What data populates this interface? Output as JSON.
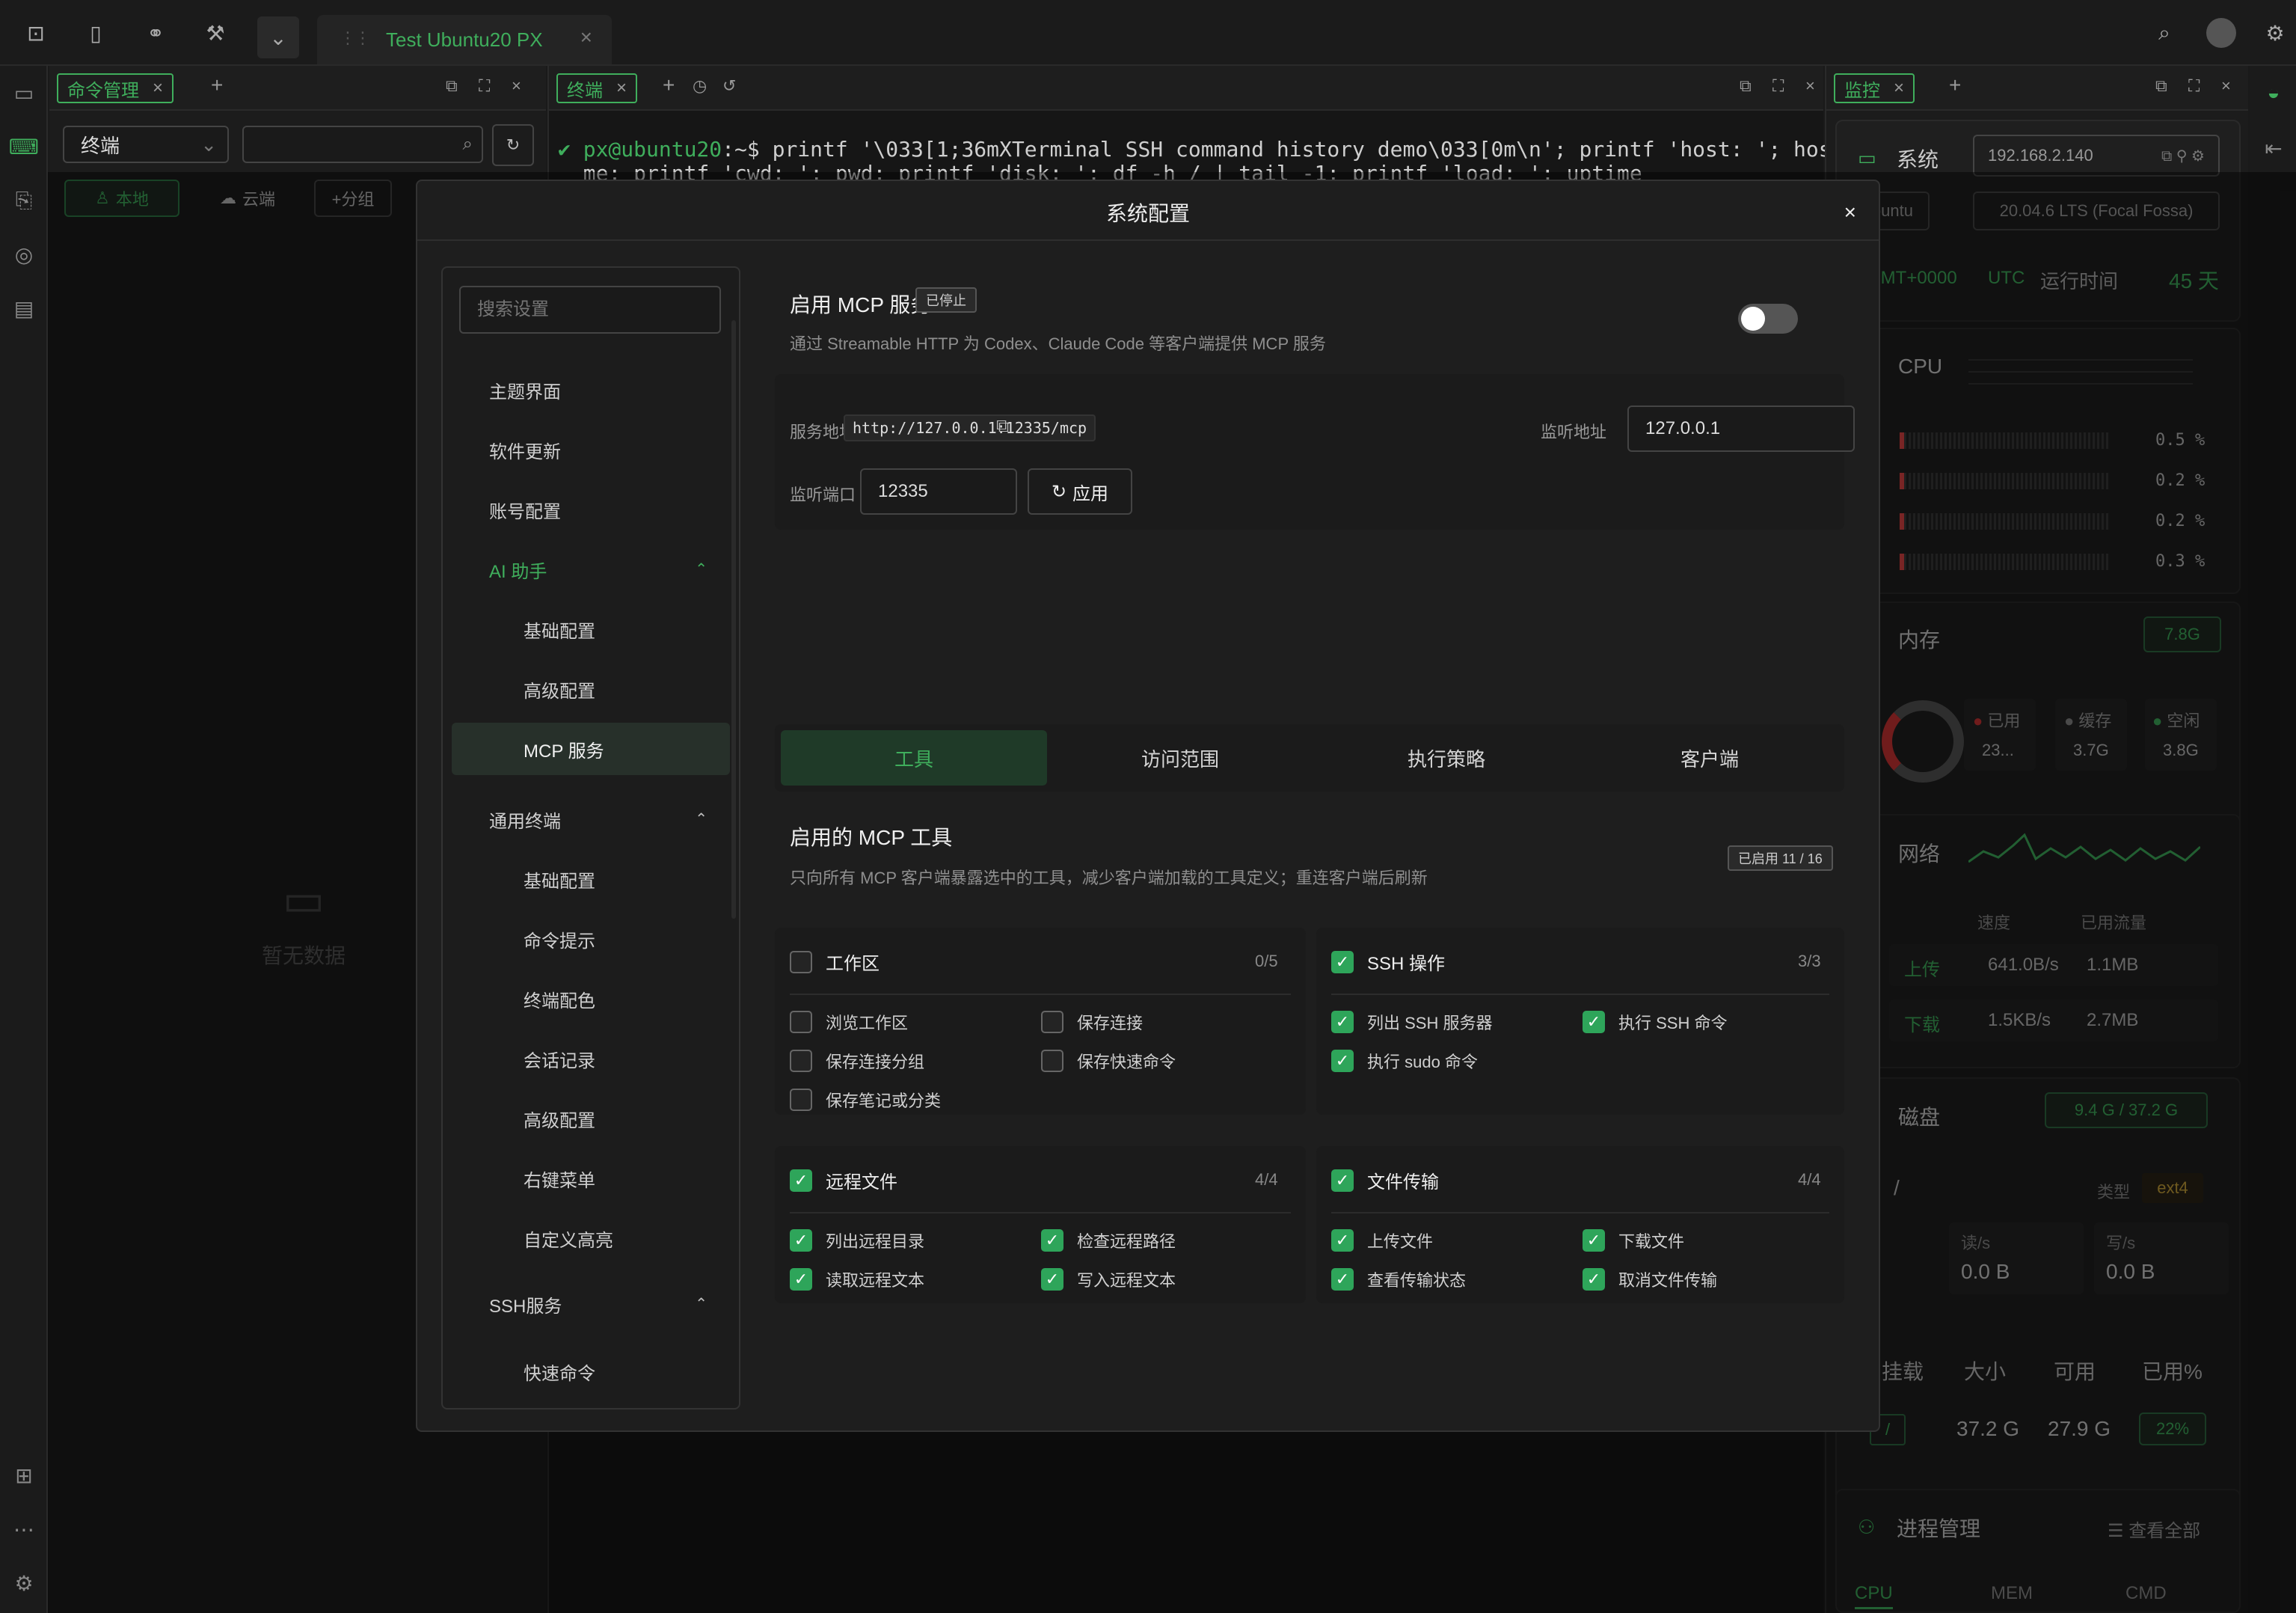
{
  "topbar": {
    "active_tab_title": "Test Ubuntu20 PX"
  },
  "left_panel": {
    "tab_label": "命令管理",
    "filter_select": "终端",
    "btn_local": "本地",
    "btn_cloud": "云端",
    "btn_add_group": "+分组",
    "empty_text": "暂无数据"
  },
  "terminal": {
    "tab_label": "终端",
    "prompt_user": "px@ubuntu20",
    "prompt_rest": ":~$ printf '\\033[1;36mXTerminal SSH command history demo\\033[0m\\n'; printf 'host: '; hostna",
    "line2": "me; printf 'cwd: '; pwd; printf 'disk: '; df -h / | tail -1; printf 'load: '; uptime"
  },
  "monitor": {
    "tab_label": "监控",
    "system_label": "系统",
    "ip": "192.168.2.140",
    "os_name": "Ubuntu",
    "os_version": "20.04.6 LTS (Focal Fossa)",
    "timezone": "GMT+0000",
    "tz_name": "UTC",
    "uptime_label": "运行时间",
    "uptime_value": "45 天",
    "cpu_label": "CPU",
    "cpu_values": [
      "0.5 %",
      "0.2 %",
      "0.2 %",
      "0.3 %"
    ],
    "mem_label": "内存",
    "mem_total": "7.8G",
    "mem_used_label": "已用",
    "mem_used": "23...",
    "mem_cache_label": "缓存",
    "mem_cache": "3.7G",
    "mem_free_label": "空闲",
    "mem_free": "3.8G",
    "net_label": "网络",
    "net_speed_h": "速度",
    "net_traffic_h": "已用流量",
    "net_up_label": "上传",
    "net_up_speed": "641.0B/s",
    "net_up_traffic": "1.1MB",
    "net_down_label": "下载",
    "net_down_speed": "1.5KB/s",
    "net_down_traffic": "2.7MB",
    "disk_label": "磁盘",
    "disk_usage": "9.4 G / 37.2 G",
    "disk_mount": "/",
    "disk_type_label": "类型",
    "disk_type": "ext4",
    "disk_read_label": "读/s",
    "disk_read": "0.0 B",
    "disk_write_label": "写/s",
    "disk_write": "0.0 B",
    "disk_cols": [
      "挂载",
      "大小",
      "可用",
      "已用%"
    ],
    "disk_row": {
      "mount": "/",
      "size": "37.2 G",
      "avail": "27.9 G",
      "pct": "22%"
    },
    "proc_label": "进程管理",
    "proc_view_all": "查看全部",
    "proc_cols": [
      "CPU",
      "MEM",
      "CMD"
    ]
  },
  "modal": {
    "title": "系统配置",
    "search_placeholder": "搜索设置",
    "nav": [
      {
        "label": "主题界面"
      },
      {
        "label": "软件更新"
      },
      {
        "label": "账号配置"
      },
      {
        "label": "AI 助手"
      },
      {
        "label": "基础配置"
      },
      {
        "label": "高级配置"
      },
      {
        "label": "MCP 服务"
      },
      {
        "label": "通用终端"
      },
      {
        "label": "基础配置"
      },
      {
        "label": "命令提示"
      },
      {
        "label": "终端配色"
      },
      {
        "label": "会话记录"
      },
      {
        "label": "高级配置"
      },
      {
        "label": "右键菜单"
      },
      {
        "label": "自定义高亮"
      },
      {
        "label": "SSH服务"
      },
      {
        "label": "快速命令"
      }
    ],
    "mcp": {
      "title": "启用 MCP 服务",
      "status_badge": "已停止",
      "description": "通过 Streamable HTTP 为 Codex、Claude Code 等客户端提供 MCP 服务",
      "enabled": false,
      "service_addr_label": "服务地址",
      "service_addr": "http://127.0.0.1:12335/mcp",
      "listen_addr_label": "监听地址",
      "listen_addr": "127.0.0.1",
      "listen_port_label": "监听端口",
      "listen_port": "12335",
      "apply_label": "应用"
    },
    "tabs": [
      "工具",
      "访问范围",
      "执行策略",
      "客户端"
    ],
    "tools": {
      "title": "启用的 MCP 工具",
      "description": "只向所有 MCP 客户端暴露选中的工具，减少客户端加载的工具定义；重连客户端后刷新",
      "enabled_badge": "已启用 11 / 16",
      "groups": [
        {
          "name": "工作区",
          "count": "0/5",
          "checked": false,
          "items": [
            {
              "label": "浏览工作区",
              "checked": false
            },
            {
              "label": "保存连接",
              "checked": false
            },
            {
              "label": "保存连接分组",
              "checked": false
            },
            {
              "label": "保存快速命令",
              "checked": false
            },
            {
              "label": "保存笔记或分类",
              "checked": false
            }
          ]
        },
        {
          "name": "SSH 操作",
          "count": "3/3",
          "checked": true,
          "items": [
            {
              "label": "列出 SSH 服务器",
              "checked": true
            },
            {
              "label": "执行 SSH 命令",
              "checked": true
            },
            {
              "label": "执行 sudo 命令",
              "checked": true
            }
          ]
        },
        {
          "name": "远程文件",
          "count": "4/4",
          "checked": true,
          "items": [
            {
              "label": "列出远程目录",
              "checked": true
            },
            {
              "label": "检查远程路径",
              "checked": true
            },
            {
              "label": "读取远程文本",
              "checked": true
            },
            {
              "label": "写入远程文本",
              "checked": true
            }
          ]
        },
        {
          "name": "文件传输",
          "count": "4/4",
          "checked": true,
          "items": [
            {
              "label": "上传文件",
              "checked": true
            },
            {
              "label": "下载文件",
              "checked": true
            },
            {
              "label": "查看传输状态",
              "checked": true
            },
            {
              "label": "取消文件传输",
              "checked": true
            }
          ]
        }
      ]
    }
  },
  "colors": {
    "accent": "#3fae5c",
    "bg": "#1a1a1a"
  }
}
